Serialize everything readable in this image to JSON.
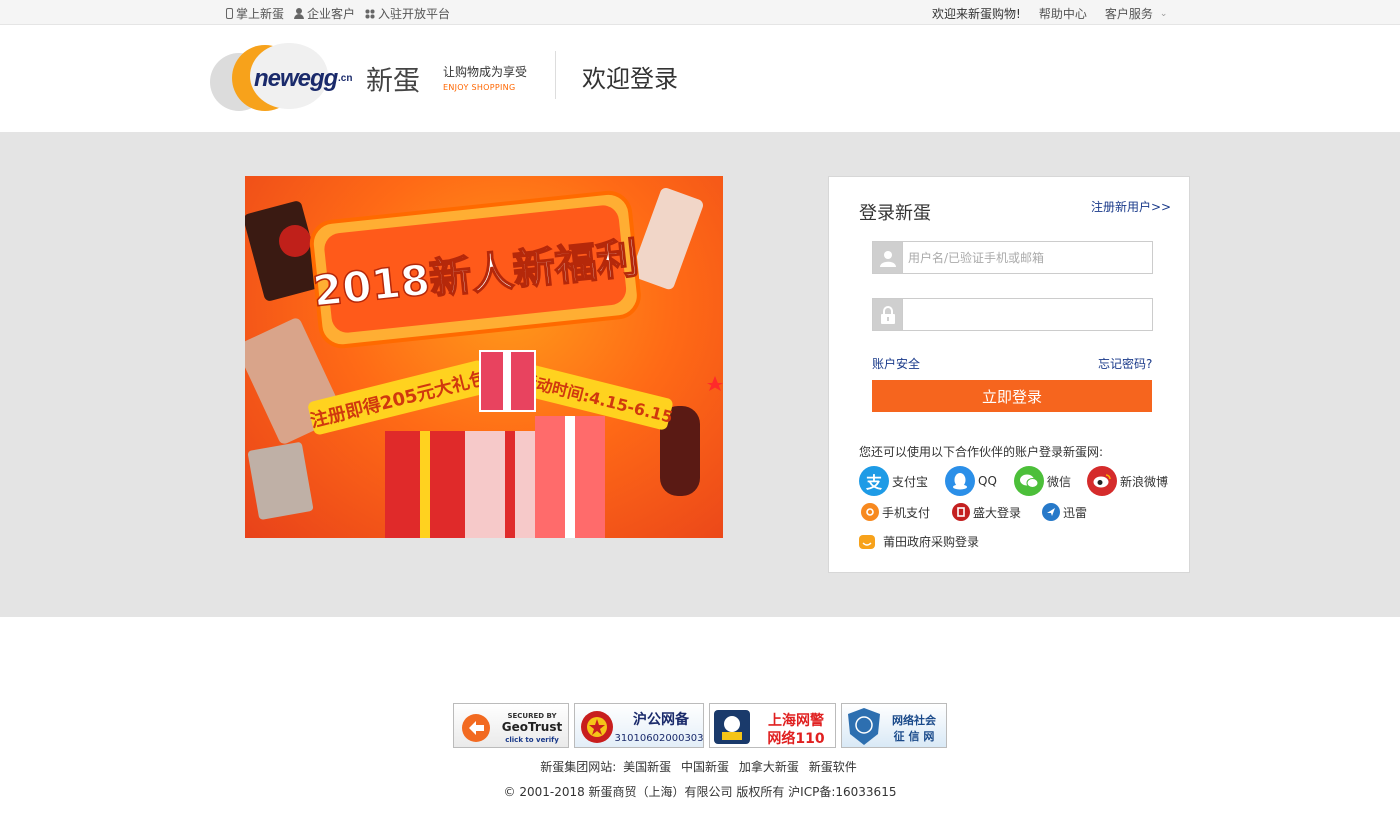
{
  "topbar": {
    "mobile": "掌上新蛋",
    "enterprise": "企业客户",
    "open_platform": "入驻开放平台",
    "welcome": "欢迎来新蛋购物!",
    "help": "帮助中心",
    "service": "客户服务"
  },
  "header": {
    "logo_word": "newegg",
    "logo_suffix": ".cn",
    "brand_cn": "新蛋",
    "slogan": "让购物成为享受",
    "slogan_en": "ENJOY SHOPPING",
    "title": "欢迎登录"
  },
  "banner": {
    "headline": "2018新人新福利",
    "sub_left": "注册即得205元大礼包",
    "sub_right": "活动时间:4.15-6.15"
  },
  "login": {
    "title": "登录新蛋",
    "register": "注册新用户>>",
    "username_placeholder": "用户名/已验证手机或邮箱",
    "password_value": "",
    "account_security": "账户安全",
    "forgot_password": "忘记密码?",
    "submit": "立即登录",
    "partner_tip": "您还可以使用以下合作伙伴的账户登录新蛋网:",
    "partners": {
      "alipay": "支付宝",
      "qq": "QQ",
      "wechat": "微信",
      "weibo": "新浪微博",
      "mobile_pay": "手机支付",
      "shanda": "盛大登录",
      "xunlei": "迅雷",
      "putian": "莆田政府采购登录"
    },
    "partner_glyphs": {
      "alipay": "支"
    }
  },
  "badges": {
    "geotrust_top": "SECURED BY",
    "geotrust_name": "GeoTrust",
    "geotrust_sub": "click to verify",
    "hgw_title": "沪公网备",
    "hgw_no": "31010602000303",
    "sh110_line1": "上海网警",
    "sh110_line2": "网络110",
    "zx_line1": "网络社会",
    "zx_line2": "征 信 网"
  },
  "footer": {
    "group_label": "新蛋集团网站:",
    "links": [
      "美国新蛋",
      "中国新蛋",
      "加拿大新蛋",
      "新蛋软件"
    ],
    "copyright": "© 2001-2018  新蛋商贸（上海）有限公司  版权所有  沪ICP备:16033615"
  },
  "colors": {
    "accent": "#f6651e",
    "link_blue": "#1a3a8a",
    "band_gray": "#e4e4e4"
  }
}
